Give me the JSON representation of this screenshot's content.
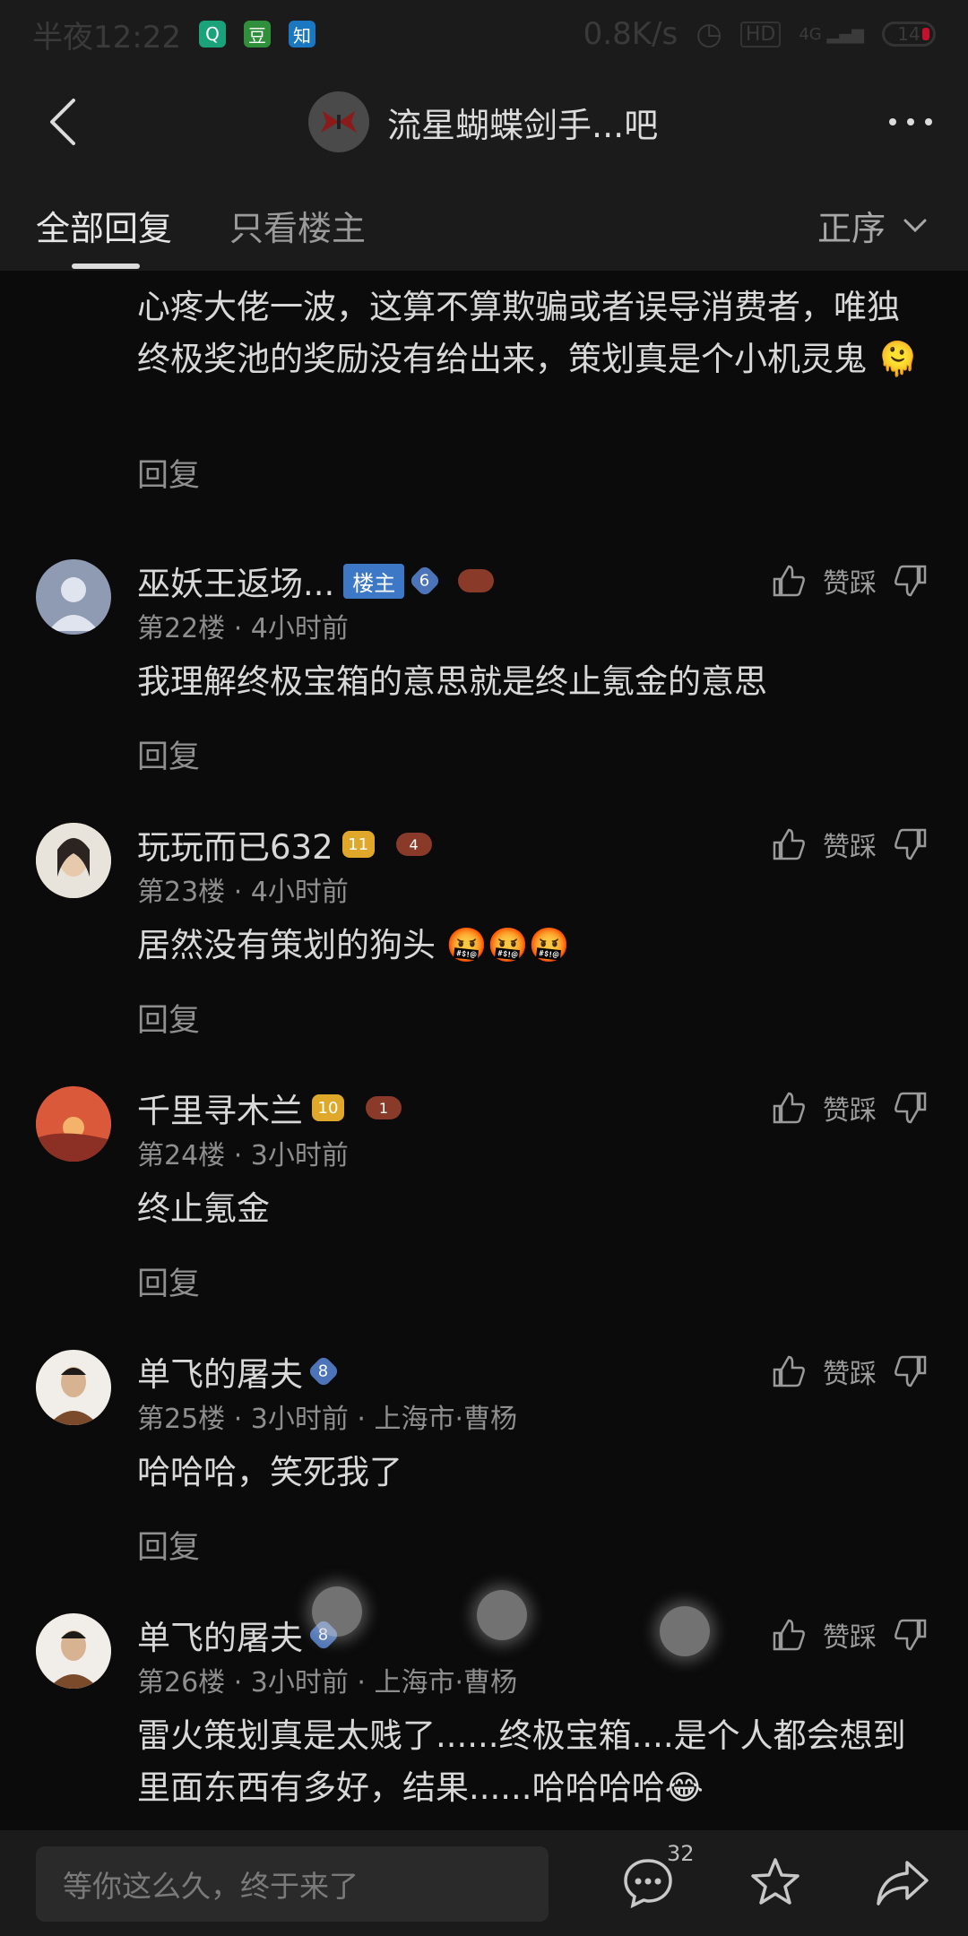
{
  "status_bar": {
    "time": "半夜12:22",
    "app_icons": [
      "Q",
      "豆",
      "知"
    ],
    "speed": "0.8K/s",
    "hd": "HD",
    "network": "4G",
    "battery": "14"
  },
  "header": {
    "title": "流星蝴蝶剑手...吧"
  },
  "tabs": {
    "all": "全部回复",
    "owner_only": "只看楼主",
    "sort": "正序"
  },
  "feed": {
    "partial_post": {
      "content": "心疼大佬一波，这算不算欺骗或者误导消费者，唯独终极奖池的奖励没有给出来，策划真是个小机灵鬼",
      "emoji": "🫠",
      "reply_label": "回复"
    },
    "posts": [
      {
        "username": "巫妖王返场...",
        "owner_badge": "楼主",
        "level": "6",
        "level_color": "#4d74b8",
        "meta": "第22楼 · 4小时前",
        "content": "我理解终极宝箱的意思就是终止氪金的意思",
        "vote_label": "赞踩",
        "reply_label": "回复",
        "avatar_color": "#8e9bb3"
      },
      {
        "username": "玩玩而已632",
        "level": "11",
        "level_color": "#e0a82a",
        "meta": "第23楼 · 4小时前",
        "content": "居然没有策划的狗头 🤬🤬🤬",
        "vote_label": "赞踩",
        "reply_label": "回复",
        "gamepad": "4",
        "avatar_color": "#c9b79a"
      },
      {
        "username": "千里寻木兰",
        "level": "10",
        "level_color": "#e0a82a",
        "meta": "第24楼 · 3小时前",
        "content": "终止氪金",
        "vote_label": "赞踩",
        "reply_label": "回复",
        "gamepad": "1",
        "avatar_color": "#c8462f"
      },
      {
        "username": "单飞的屠夫",
        "level": "8",
        "level_color": "#4d74b8",
        "meta": "第25楼 · 3小时前 · 上海市·曹杨",
        "content": "哈哈哈，笑死我了",
        "vote_label": "赞踩",
        "reply_label": "回复",
        "avatar_color": "#6b5a4a"
      },
      {
        "username": "单飞的屠夫",
        "level": "8",
        "level_color": "#4d74b8",
        "meta": "第26楼 · 3小时前 · 上海市·曹杨",
        "content": "雷火策划真是太贱了......终极宝箱....是个人都会想到里面东西有多好，结果......哈哈哈哈😂",
        "vote_label": "赞踩",
        "reply_label": "回复",
        "avatar_color": "#6b5a4a"
      }
    ]
  },
  "bottom_bar": {
    "input_placeholder": "等你这么久，终于来了",
    "comment_count": "32"
  }
}
